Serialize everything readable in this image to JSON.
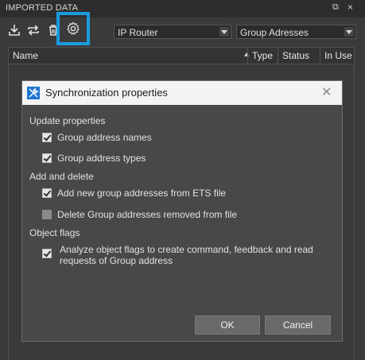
{
  "panel": {
    "title": "IMPORTED DATA",
    "pin_glyph": "⧉",
    "close_glyph": "×"
  },
  "toolbar": {
    "icons": [
      "import-icon",
      "sync-icon",
      "delete-icon",
      "settings-icon"
    ],
    "highlight_color": "#1a9be0",
    "source_combo": "IP Router",
    "filter_combo": "Group Adresses"
  },
  "table": {
    "columns": [
      "Name",
      "Type",
      "Status",
      "In Use"
    ]
  },
  "dialog": {
    "title": "Synchronization properties",
    "close_glyph": "✕",
    "sections": [
      {
        "label": "Update properties",
        "options": [
          {
            "label": "Group address names",
            "checked": true
          },
          {
            "label": "Group address types",
            "checked": true
          }
        ]
      },
      {
        "label": "Add and delete",
        "options": [
          {
            "label": "Add new group addresses from ETS file",
            "checked": true
          },
          {
            "label": "Delete Group addresses removed from file",
            "checked": false
          }
        ]
      },
      {
        "label": "Object flags",
        "options": [
          {
            "label": "Analyze object flags to create command, feedback and read requests of Group address",
            "checked": true
          }
        ]
      }
    ],
    "ok_label": "OK",
    "cancel_label": "Cancel"
  }
}
